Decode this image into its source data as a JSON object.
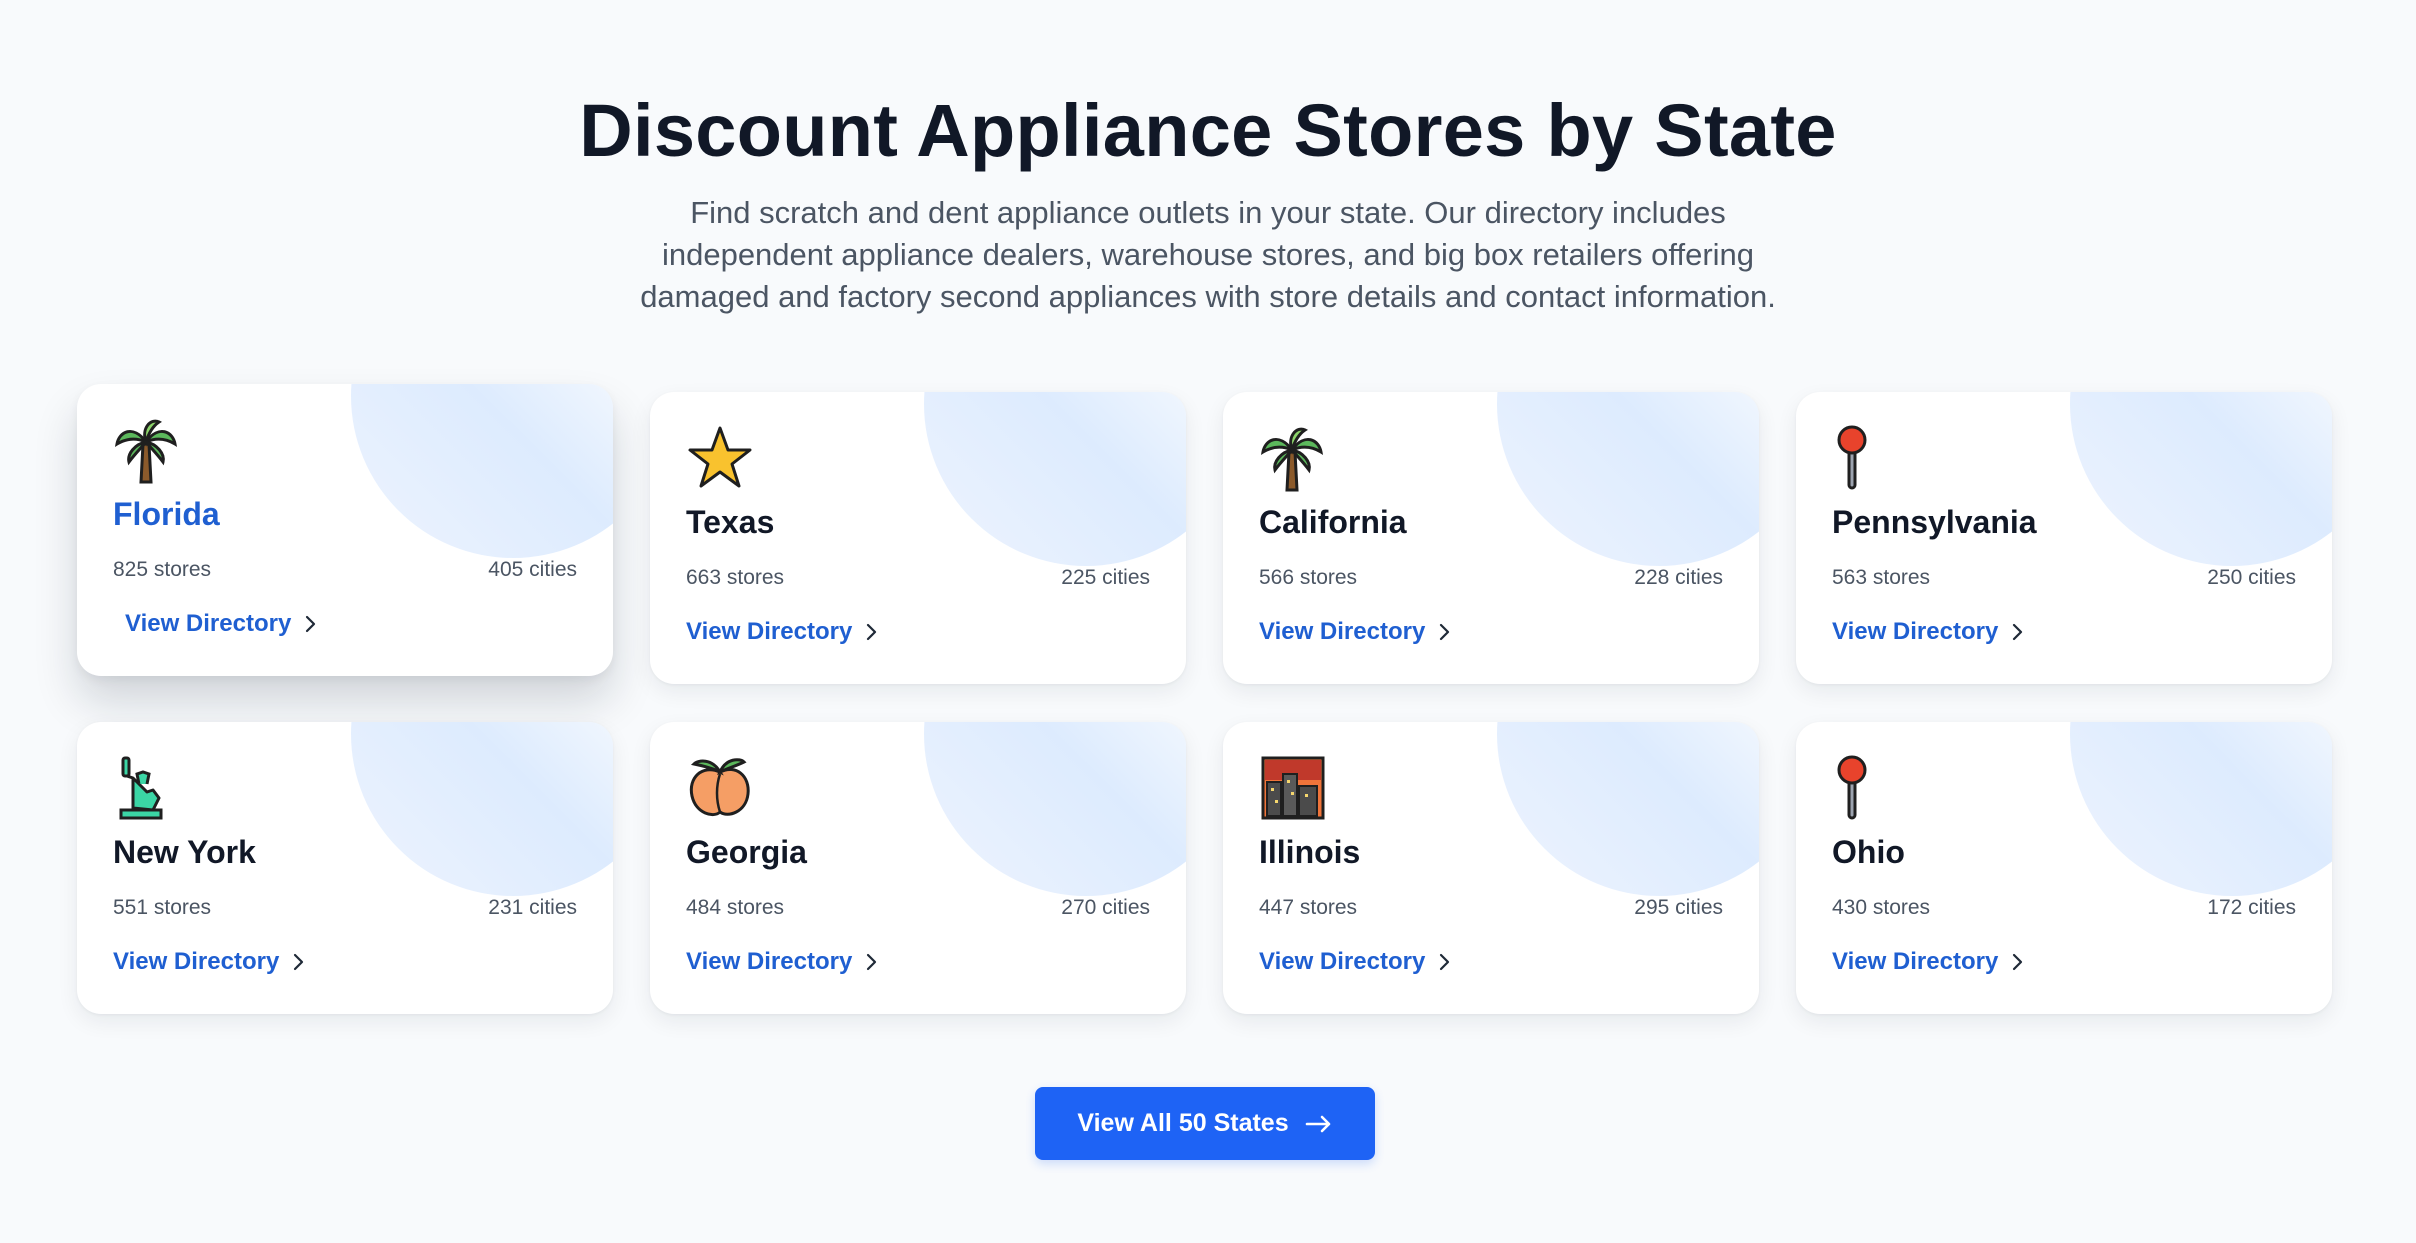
{
  "header": {
    "title": "Discount Appliance Stores by State",
    "description": "Find scratch and dent appliance outlets in your state. Our directory includes independent appliance dealers, warehouse stores, and big box retailers offering damaged and factory second appliances with store details and contact information."
  },
  "states": [
    {
      "name": "Florida",
      "stores": "825 stores",
      "cities": "405 cities",
      "link": "View Directory",
      "icon": "palm-tree-icon"
    },
    {
      "name": "Texas",
      "stores": "663 stores",
      "cities": "225 cities",
      "link": "View Directory",
      "icon": "star-icon"
    },
    {
      "name": "California",
      "stores": "566 stores",
      "cities": "228 cities",
      "link": "View Directory",
      "icon": "palm-tree-icon"
    },
    {
      "name": "Pennsylvania",
      "stores": "563 stores",
      "cities": "250 cities",
      "link": "View Directory",
      "icon": "pushpin-icon"
    },
    {
      "name": "New York",
      "stores": "551 stores",
      "cities": "231 cities",
      "link": "View Directory",
      "icon": "statue-of-liberty-icon"
    },
    {
      "name": "Georgia",
      "stores": "484 stores",
      "cities": "270 cities",
      "link": "View Directory",
      "icon": "peach-icon"
    },
    {
      "name": "Illinois",
      "stores": "447 stores",
      "cities": "295 cities",
      "link": "View Directory",
      "icon": "city-skyline-icon"
    },
    {
      "name": "Ohio",
      "stores": "430 stores",
      "cities": "172 cities",
      "link": "View Directory",
      "icon": "pushpin-icon"
    }
  ],
  "cta": {
    "label": "View All 50 States",
    "icon": "arrow-right-icon"
  },
  "colors": {
    "accent": "#1f5fd1",
    "button": "#1e63f5",
    "background": "#f8fafc",
    "heading": "#111827",
    "muted": "#4b5563"
  }
}
